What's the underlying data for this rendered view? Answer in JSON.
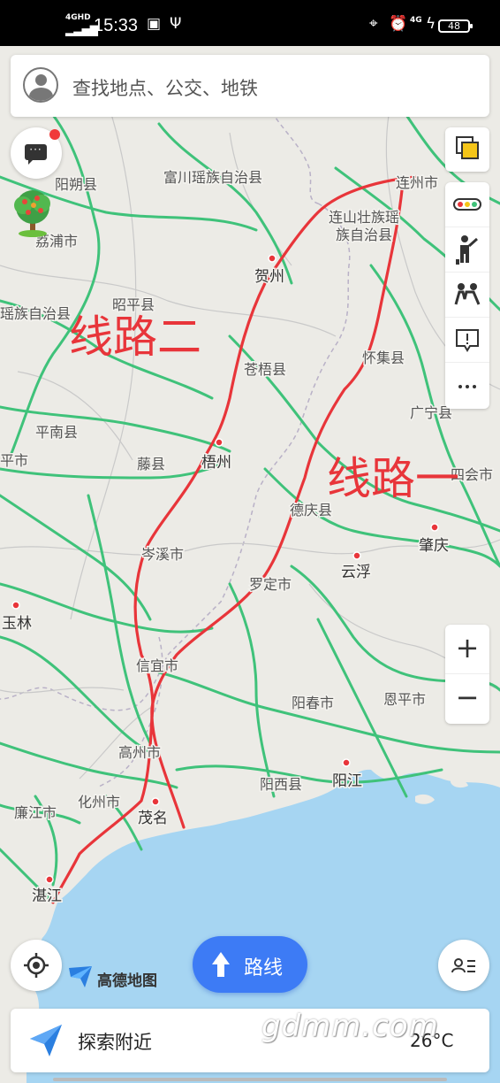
{
  "status_bar": {
    "network_label": "4GHD",
    "time": "15:33",
    "network_label_2": "4G",
    "battery": "48"
  },
  "search": {
    "placeholder": "查找地点、公交、地铁"
  },
  "map": {
    "labels": [
      {
        "text": "阳朔县"
      },
      {
        "text": "富川瑶族自治县"
      },
      {
        "text": "连州市"
      },
      {
        "text": "荔浦市"
      },
      {
        "text": "连山壮族瑶"
      },
      {
        "text": "族自治县"
      },
      {
        "text": "贺州"
      },
      {
        "text": "昭平县"
      },
      {
        "text": "瑶族自治县"
      },
      {
        "text": "苍梧县"
      },
      {
        "text": "怀集县"
      },
      {
        "text": "平南县"
      },
      {
        "text": "广宁县"
      },
      {
        "text": "藤县"
      },
      {
        "text": "梧州"
      },
      {
        "text": "平市"
      },
      {
        "text": "四会市"
      },
      {
        "text": "德庆县"
      },
      {
        "text": "岑溪市"
      },
      {
        "text": "肇庆"
      },
      {
        "text": "云浮"
      },
      {
        "text": "罗定市"
      },
      {
        "text": "玉林"
      },
      {
        "text": "信宜市"
      },
      {
        "text": "阳春市"
      },
      {
        "text": "恩平市"
      },
      {
        "text": "高州市"
      },
      {
        "text": "阳江"
      },
      {
        "text": "阳西县"
      },
      {
        "text": "廉江市"
      },
      {
        "text": "化州市"
      },
      {
        "text": "茂名"
      },
      {
        "text": "湛江"
      }
    ],
    "annotations": {
      "route_two": "线路二",
      "route_one": "线路一"
    },
    "road_color": "#3fc27a",
    "route_color": "#e8353a",
    "sea_color": "#a6d5f2"
  },
  "buttons": {
    "message": "···",
    "route": "路线",
    "zoom_in": "+",
    "zoom_out": "−"
  },
  "logo": {
    "text": "高德地图"
  },
  "bottom": {
    "explore": "探索附近",
    "weather": "26°C"
  },
  "watermark": "gdmm.com"
}
